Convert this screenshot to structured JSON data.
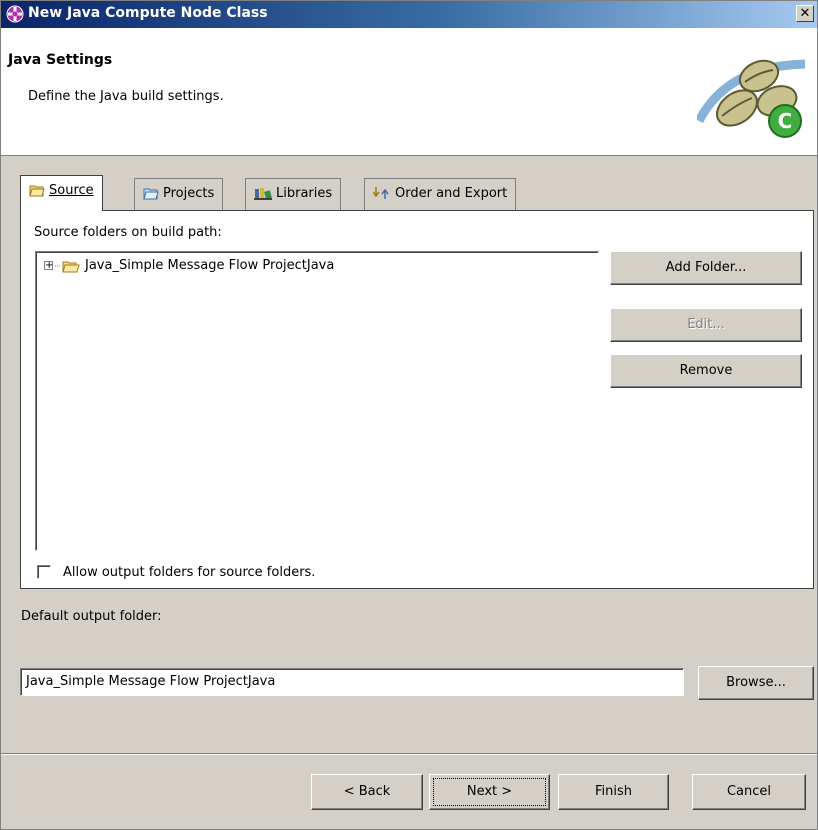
{
  "window": {
    "title": "New Java Compute Node Class",
    "close_glyph": "✕"
  },
  "header": {
    "title": "Java Settings",
    "description": "Define the Java build settings."
  },
  "tabs": [
    {
      "label": "Source",
      "icon": "source-folder-icon",
      "active": true
    },
    {
      "label": "Projects",
      "icon": "projects-folder-icon",
      "active": false
    },
    {
      "label": "Libraries",
      "icon": "libraries-icon",
      "active": false
    },
    {
      "label": "Order and Export",
      "icon": "order-export-icon",
      "active": false
    }
  ],
  "source_panel": {
    "label": "Source folders on build path:",
    "tree_items": [
      {
        "label": "Java_Simple Message Flow ProjectJava",
        "expander": "+"
      }
    ],
    "buttons": {
      "add_folder": "Add Folder...",
      "edit": "Edit...",
      "remove": "Remove"
    },
    "allow_output_folders": {
      "label": "Allow output folders for source folders.",
      "checked": false
    }
  },
  "output": {
    "label": "Default output folder:",
    "value": "Java_Simple Message Flow ProjectJava",
    "browse": "Browse..."
  },
  "footer": {
    "back": "< Back",
    "next": "Next >",
    "finish": "Finish",
    "cancel": "Cancel"
  },
  "colors": {
    "title_gradient_start": "#0a246a",
    "dialog_bg": "#d4d0c8",
    "folder_yellow": "#f5d76e"
  }
}
